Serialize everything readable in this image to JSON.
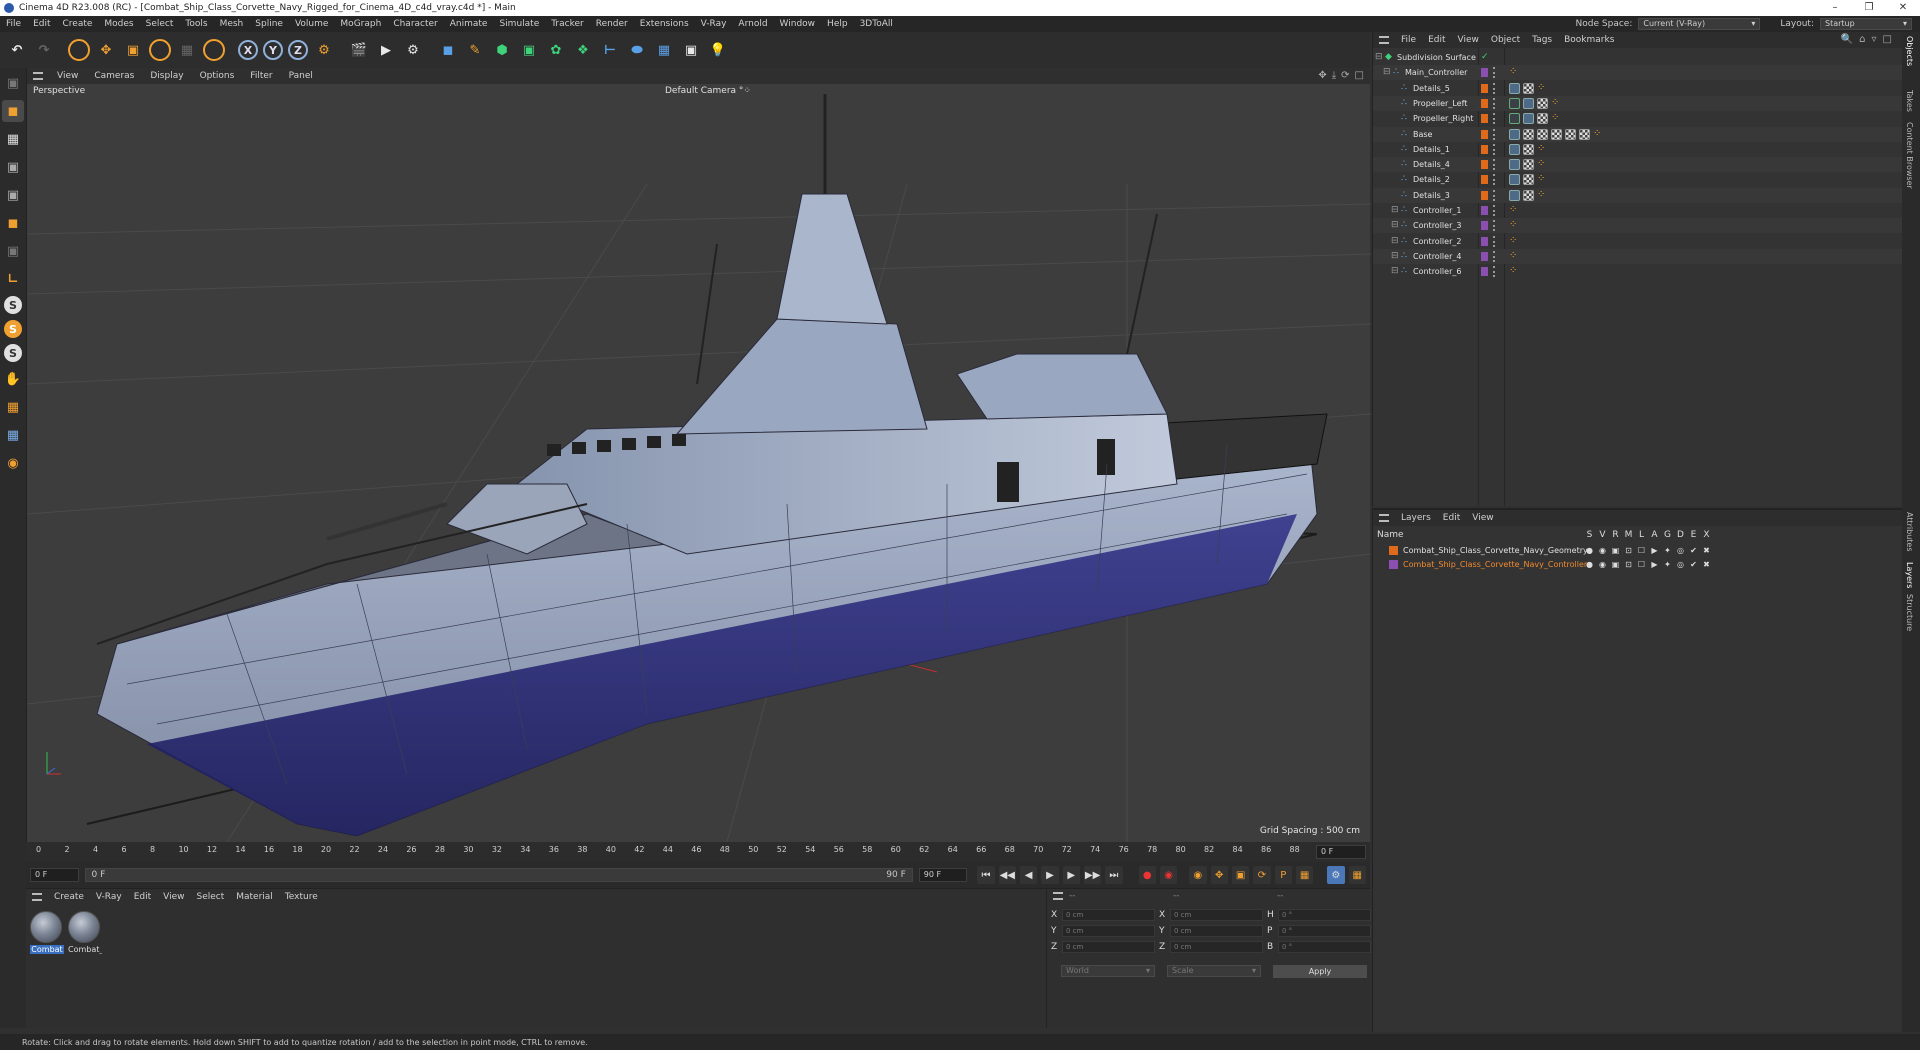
{
  "window": {
    "title": "Cinema 4D R23.008 (RC) - [Combat_Ship_Class_Corvette_Navy_Rigged_for_Cinema_4D_c4d_vray.c4d *] - Main",
    "controls": [
      "–",
      "❐",
      "✕"
    ]
  },
  "menu": [
    "File",
    "Edit",
    "Create",
    "Modes",
    "Select",
    "Tools",
    "Mesh",
    "Spline",
    "Volume",
    "MoGraph",
    "Character",
    "Animate",
    "Simulate",
    "Tracker",
    "Render",
    "Extensions",
    "V-Ray",
    "Arnold",
    "Window",
    "Help",
    "3DToAll"
  ],
  "node_space": {
    "label": "Node Space:",
    "value": "Current (V-Ray)"
  },
  "layout": {
    "label": "Layout:",
    "value": "Startup"
  },
  "toolbar": {
    "undo": "↶",
    "redo": "↷",
    "axes": [
      "X",
      "Y",
      "Z"
    ]
  },
  "viewport": {
    "menu": [
      "View",
      "Cameras",
      "Display",
      "Options",
      "Filter",
      "Panel"
    ],
    "projection": "Perspective",
    "camera": "Default Camera °⁘",
    "grid_spacing": "Grid Spacing : 500 cm"
  },
  "timeline": {
    "ticks": [
      "0",
      "2",
      "4",
      "6",
      "8",
      "10",
      "12",
      "14",
      "16",
      "18",
      "20",
      "22",
      "24",
      "26",
      "28",
      "30",
      "32",
      "34",
      "36",
      "38",
      "40",
      "42",
      "44",
      "46",
      "48",
      "50",
      "52",
      "54",
      "56",
      "58",
      "60",
      "62",
      "64",
      "66",
      "68",
      "70",
      "72",
      "74",
      "76",
      "78",
      "80",
      "82",
      "84",
      "86",
      "88",
      "90"
    ],
    "current_frame": "0 F"
  },
  "playback": {
    "start": "0 F",
    "preview_start": "0 F",
    "preview_end": "90 F",
    "end": "90 F"
  },
  "material_panel": {
    "menu": [
      "Create",
      "V-Ray",
      "Edit",
      "View",
      "Select",
      "Material",
      "Texture"
    ],
    "materials": [
      "Combat",
      "Combat_"
    ]
  },
  "coordinates": {
    "headers": [
      "--",
      "--",
      "--"
    ],
    "rows": [
      {
        "a": "X",
        "av": "0 cm",
        "b": "X",
        "bv": "0 cm",
        "c": "H",
        "cv": "0 °"
      },
      {
        "a": "Y",
        "av": "0 cm",
        "b": "Y",
        "bv": "0 cm",
        "c": "P",
        "cv": "0 °"
      },
      {
        "a": "Z",
        "av": "0 cm",
        "b": "Z",
        "bv": "0 cm",
        "c": "B",
        "cv": "0 °"
      }
    ],
    "mode": "World",
    "transform": "Scale",
    "apply": "Apply"
  },
  "objects_panel": {
    "menu": [
      "File",
      "Edit",
      "View",
      "Object",
      "Tags",
      "Bookmarks"
    ],
    "items": [
      {
        "name": "Subdivision Surface",
        "depth": 0,
        "color": ""
      },
      {
        "name": "Main_Controller",
        "depth": 1,
        "color": "#8a4fb0"
      },
      {
        "name": "Details_5",
        "depth": 2,
        "color": "#e06a1c"
      },
      {
        "name": "Propeller_Left",
        "depth": 2,
        "color": "#e06a1c"
      },
      {
        "name": "Propeller_Right",
        "depth": 2,
        "color": "#e06a1c"
      },
      {
        "name": "Base",
        "depth": 2,
        "color": "#e06a1c"
      },
      {
        "name": "Details_1",
        "depth": 2,
        "color": "#e06a1c"
      },
      {
        "name": "Details_4",
        "depth": 2,
        "color": "#e06a1c"
      },
      {
        "name": "Details_2",
        "depth": 2,
        "color": "#e06a1c"
      },
      {
        "name": "Details_3",
        "depth": 2,
        "color": "#e06a1c"
      },
      {
        "name": "Controller_1",
        "depth": 2,
        "color": "#8a4fb0"
      },
      {
        "name": "Controller_3",
        "depth": 2,
        "color": "#8a4fb0"
      },
      {
        "name": "Controller_2",
        "depth": 2,
        "color": "#8a4fb0"
      },
      {
        "name": "Controller_4",
        "depth": 2,
        "color": "#8a4fb0"
      },
      {
        "name": "Controller_6",
        "depth": 2,
        "color": "#8a4fb0"
      }
    ]
  },
  "layers_panel": {
    "menu": [
      "Layers",
      "Edit",
      "View"
    ],
    "header": {
      "name": "Name",
      "flags": [
        "S",
        "V",
        "R",
        "M",
        "L",
        "A",
        "G",
        "D",
        "E",
        "X"
      ]
    },
    "layers": [
      {
        "name": "Combat_Ship_Class_Corvette_Navy_Geometry",
        "color": "#e06a1c",
        "text_color": "#e0e0e0"
      },
      {
        "name": "Combat_Ship_Class_Corvette_Navy_Controllers",
        "color": "#8a4fb0",
        "text_color": "#f08a30"
      }
    ]
  },
  "side_tabs": [
    "Objects",
    "Takes",
    "Content Browser",
    "Attributes",
    "Layers",
    "Structure"
  ],
  "status": "Rotate: Click and drag to rotate elements. Hold down SHIFT to add to quantize rotation / add to the selection in point mode, CTRL to remove."
}
